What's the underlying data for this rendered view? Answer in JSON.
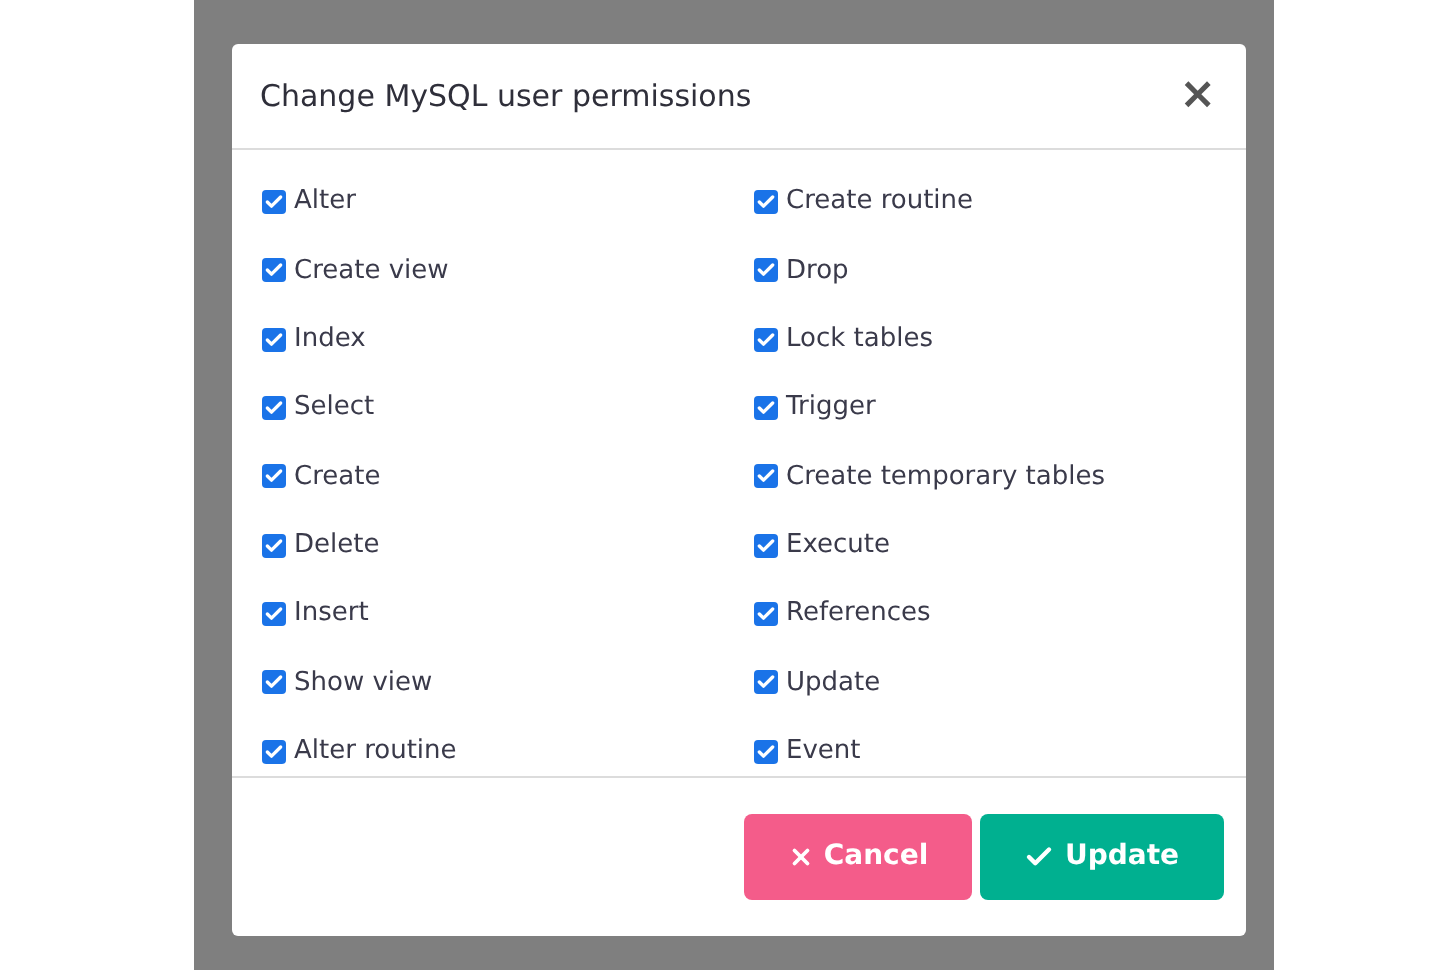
{
  "dialog": {
    "title": "Change MySQL user permissions",
    "close": "×",
    "permissions": [
      {
        "label": "Alter",
        "checked": true
      },
      {
        "label": "Create routine",
        "checked": true
      },
      {
        "label": "Create view",
        "checked": true
      },
      {
        "label": "Drop",
        "checked": true
      },
      {
        "label": "Index",
        "checked": true
      },
      {
        "label": "Lock tables",
        "checked": true
      },
      {
        "label": "Select",
        "checked": true
      },
      {
        "label": "Trigger",
        "checked": true
      },
      {
        "label": "Create",
        "checked": true
      },
      {
        "label": "Create temporary tables",
        "checked": true
      },
      {
        "label": "Delete",
        "checked": true
      },
      {
        "label": "Execute",
        "checked": true
      },
      {
        "label": "Insert",
        "checked": true
      },
      {
        "label": "References",
        "checked": true
      },
      {
        "label": "Show view",
        "checked": true
      },
      {
        "label": "Update",
        "checked": true
      },
      {
        "label": "Alter routine",
        "checked": true
      },
      {
        "label": "Event",
        "checked": true
      }
    ],
    "buttons": [
      {
        "label": "Cancel",
        "kind": "cancel"
      },
      {
        "label": "Update",
        "kind": "confirm"
      }
    ]
  }
}
